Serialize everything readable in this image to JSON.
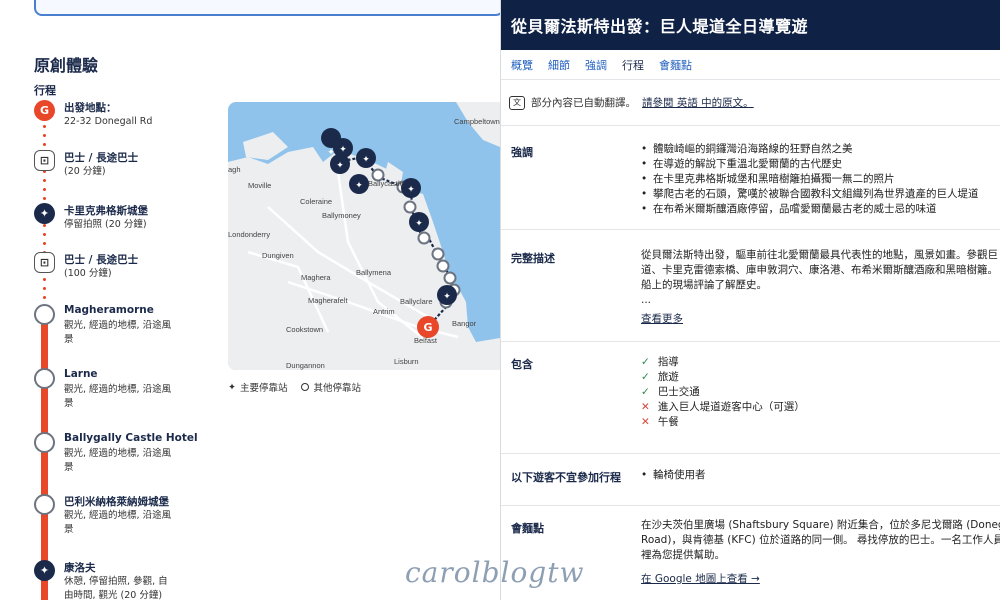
{
  "left": {
    "section_title": "原創體驗",
    "itinerary_label": "行程",
    "stops": [
      {
        "name": "出發地點：",
        "desc": "22-32 Donegall Rd",
        "marker": "start",
        "glyph": "G"
      },
      {
        "name": "巴士 / 長途巴士",
        "desc": "(20 分鐘)",
        "marker": "bus",
        "glyph": "⊡"
      },
      {
        "name": "卡里克弗格斯城堡",
        "desc": "停留拍照 (20 分鐘)",
        "marker": "main",
        "glyph": "✦"
      },
      {
        "name": "巴士 / 長途巴士",
        "desc": "(100 分鐘)",
        "marker": "bus",
        "glyph": "⊡"
      },
      {
        "name": "Magheramorne",
        "desc": "觀光, 經過的地標, 沿途風景",
        "marker": "other",
        "glyph": ""
      },
      {
        "name": "Larne",
        "desc": "觀光, 經過的地標, 沿途風景",
        "marker": "other",
        "glyph": ""
      },
      {
        "name": "Ballygally Castle Hotel",
        "desc": "觀光, 經過的地標, 沿途風景",
        "marker": "other",
        "glyph": ""
      },
      {
        "name": "巴利米納格萊納姆城堡",
        "desc": "觀光, 經過的地標, 沿途風景",
        "marker": "other",
        "glyph": ""
      },
      {
        "name": "康洛夫",
        "desc": "休憩, 停留拍照, 參觀, 自由時間, 觀光 (20 分鐘)",
        "marker": "main",
        "glyph": "✦"
      }
    ],
    "map_labels": [
      "Campbeltown",
      "Moville",
      "Coleraine",
      "Ballymoney",
      "Londonderry",
      "Dungiven",
      "Maghera",
      "Ballymena",
      "Magherafelt",
      "Antrim",
      "Ballyclare",
      "Bangor",
      "Cookstown",
      "Belfast",
      "Lisburn",
      "Dungannon",
      "Ballycastle",
      "agh"
    ],
    "legend": {
      "main": "主要停靠站",
      "other": "其他停靠站"
    }
  },
  "right": {
    "title": "從貝爾法斯特出發：巨人堤道全日導覽遊",
    "tabs": [
      "概覽",
      "細節",
      "強調",
      "行程",
      "會麵點"
    ],
    "translate_note": "部分內容已自動翻譯。",
    "translate_link": "請參閱 英語 中的原文。",
    "highlights_label": "強調",
    "highlights": [
      "體驗崎嶇的銅鑼灣沿海路線的狂野自然之美",
      "在導遊的解說下重溫北愛爾蘭的古代歷史",
      "在卡里克弗格斯城堡和黑暗樹籬拍攝獨一無二的照片",
      "攀爬古老的石頭，驚嘆於被聯合國教科文組織列為世界遺產的巨人堤道",
      "在布希米爾斯釀酒廠停留，品嚐愛爾蘭最古老的威士忌的味道"
    ],
    "description_label": "完整描述",
    "description_lines": [
      "從貝爾法斯特出發，驅車前往北愛爾蘭最具代表性的地點，風景如畫。參觀巨",
      "道、卡里克雷德索橋、庫申敦洞穴、康洛港、布希米爾斯釀酒廠和黑暗樹籬。",
      "船上的現場評論了解歷史。",
      "..."
    ],
    "see_more": "查看更多",
    "includes_label": "包含",
    "includes": [
      {
        "text": "指導",
        "ok": true
      },
      {
        "text": "旅遊",
        "ok": true
      },
      {
        "text": "巴士交通",
        "ok": true
      },
      {
        "text": "進入巨人堤道遊客中心（可選）",
        "ok": false
      },
      {
        "text": "午餐",
        "ok": false
      }
    ],
    "not_suitable_label": "以下遊客不宜參加行程",
    "not_suitable": [
      "輪椅使用者"
    ],
    "meeting_label": "會麵點",
    "meeting_lines": [
      "在沙夫茨伯里廣場 (Shaftsbury Square) 附近集合，位於多尼戈爾路 (Donegall",
      "Road)，與肯德基 (KFC) 位於道路的同一側。 尋找停放的巴士。一名工作人員",
      "裡為您提供幫助。"
    ],
    "map_link": "在 Google 地圖上查看 →"
  },
  "watermark": "carolblogtw",
  "colors": {
    "accent": "#e8472a",
    "navy": "#0f2246",
    "link": "#1f5fbf"
  }
}
